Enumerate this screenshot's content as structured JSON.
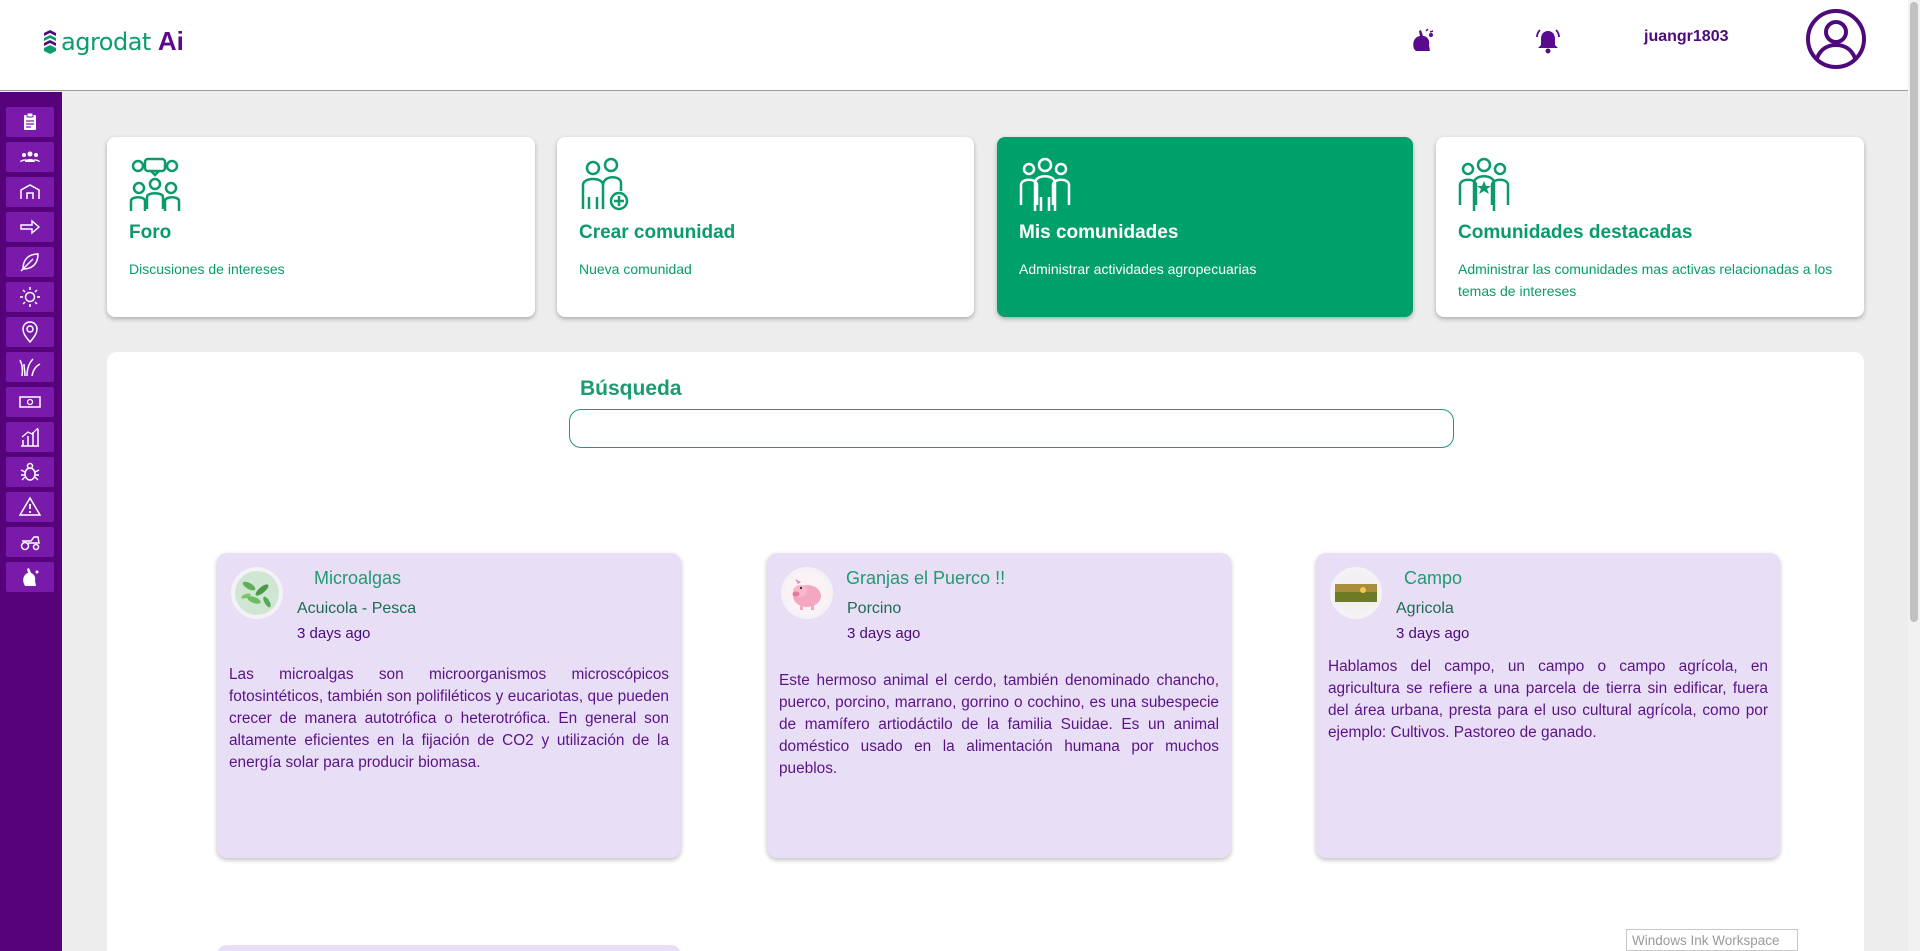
{
  "header": {
    "logo_text": "agrodat",
    "logo_ai": "Ai",
    "username": "juangr1803",
    "icons": [
      "alert-hand-icon",
      "bell-icon",
      "user-circle-icon"
    ]
  },
  "sidebar": {
    "items": [
      {
        "icon": "clipboard-icon"
      },
      {
        "icon": "community-icon"
      },
      {
        "icon": "barn-icon"
      },
      {
        "icon": "arrow-right-icon"
      },
      {
        "icon": "leaf-icon"
      },
      {
        "icon": "sun-icon"
      },
      {
        "icon": "location-pin-icon"
      },
      {
        "icon": "grass-icon"
      },
      {
        "icon": "money-icon"
      },
      {
        "icon": "chart-icon"
      },
      {
        "icon": "bug-icon"
      },
      {
        "icon": "warning-icon"
      },
      {
        "icon": "tractor-icon"
      },
      {
        "icon": "alert-hand-icon"
      }
    ]
  },
  "cards": [
    {
      "title": "Foro",
      "subtitle": "Discusiones de intereses",
      "icon": "forum-people-icon",
      "active": false
    },
    {
      "title": "Crear comunidad",
      "subtitle": "Nueva comunidad",
      "icon": "add-community-icon",
      "active": false
    },
    {
      "title": "Mis comunidades",
      "subtitle": "Administrar actividades agropecuarias",
      "icon": "my-communities-icon",
      "active": true
    },
    {
      "title": "Comunidades destacadas",
      "subtitle": "Administrar las comunidades mas activas relacionadas a los temas de intereses",
      "icon": "featured-communities-icon",
      "active": false
    }
  ],
  "search": {
    "label": "Búsqueda",
    "value": "",
    "placeholder": ""
  },
  "communities": [
    {
      "name": "Microalgas",
      "category": "Acuicola - Pesca",
      "time": "3 days ago",
      "description": "Las microalgas son microorganismos microscópicos fotosintéticos, también son polifiléticos y eucariotas, que pueden crecer de manera autotrófica o heterotrófica. En general son altamente eficientes en la fijación de CO2 y utilización de la energía solar para producir biomasa.",
      "thumb": "microalgae-image"
    },
    {
      "name": "Granjas el Puerco !!",
      "category": "Porcino",
      "time": "3 days ago",
      "description": "Este hermoso animal el cerdo, también denominado chancho, puerco, porcino, marrano, gorrino o cochino, es una subespecie de mamífero artiodáctilo de la familia Suidae. Es un animal doméstico usado en la alimentación humana por muchos pueblos.",
      "thumb": "pig-image"
    },
    {
      "name": "Campo",
      "category": "Agricola",
      "time": "3 days ago",
      "description": "Hablamos del campo, un campo o campo agrícola, en agricultura se refiere a una parcela de tierra sin edificar, fuera del área urbana, presta para el uso cultural agrícola, como por ejemplo: Cultivos. Pastoreo de ganado.",
      "thumb": "field-image"
    }
  ],
  "overlay": {
    "ink_workspace": "Windows Ink Workspace"
  },
  "colors": {
    "brand_green": "#00a06a",
    "brand_purple": "#56037b",
    "card_lavender": "#e8dff7"
  }
}
